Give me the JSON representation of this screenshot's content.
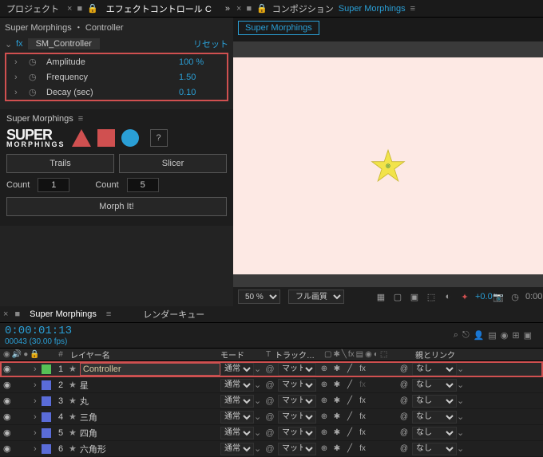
{
  "tabs": {
    "project": "プロジェクト",
    "effect_controls": "エフェクトコントロール C",
    "breadcrumb": "Super Morphings ・ Controller",
    "fx_prefix": "fx",
    "fx_name": "SM_Controller",
    "reset": "リセット"
  },
  "props": [
    {
      "name": "Amplitude",
      "val": "100 %"
    },
    {
      "name": "Frequency",
      "val": "1.50"
    },
    {
      "name": "Decay (sec)",
      "val": "0.10"
    }
  ],
  "sm": {
    "title": "Super Morphings",
    "logo_top": "SUPER",
    "logo_bot": "MORPHINGS",
    "help": "?",
    "trails": "Trails",
    "slicer": "Slicer",
    "count_label": "Count",
    "count1": "1",
    "count2": "5",
    "morph": "Morph It!"
  },
  "comp": {
    "label": "コンポジション",
    "name": "Super Morphings",
    "tab": "Super Morphings",
    "zoom": "50 %",
    "res": "フル画質",
    "exposure": "+0.0",
    "time": "0:00:0"
  },
  "tl": {
    "tab": "Super Morphings",
    "render_q": "レンダーキュー",
    "timecode": "0:00:01:13",
    "fps": "00043 (30.00 fps)",
    "col_num": "#",
    "col_name": "レイヤー名",
    "col_mode": "モード",
    "col_t": "T",
    "col_track": "トラック…",
    "col_parent": "親とリンク",
    "mode_opt": "通常",
    "track_opt": "マット …",
    "parent_opt": "なし"
  },
  "layers": [
    {
      "num": "1",
      "name": "Controller",
      "color": "#56c256",
      "sel": true,
      "fx": true,
      "boxed": true
    },
    {
      "num": "2",
      "name": "星",
      "color": "#5a6cd8",
      "sel": false,
      "fx": false,
      "boxed": false
    },
    {
      "num": "3",
      "name": "丸",
      "color": "#5a6cd8",
      "sel": false,
      "fx": true,
      "boxed": false
    },
    {
      "num": "4",
      "name": "三角",
      "color": "#5a6cd8",
      "sel": false,
      "fx": true,
      "boxed": false
    },
    {
      "num": "5",
      "name": "四角",
      "color": "#5a6cd8",
      "sel": false,
      "fx": true,
      "boxed": false
    },
    {
      "num": "6",
      "name": "六角形",
      "color": "#5a6cd8",
      "sel": false,
      "fx": true,
      "boxed": false
    }
  ]
}
